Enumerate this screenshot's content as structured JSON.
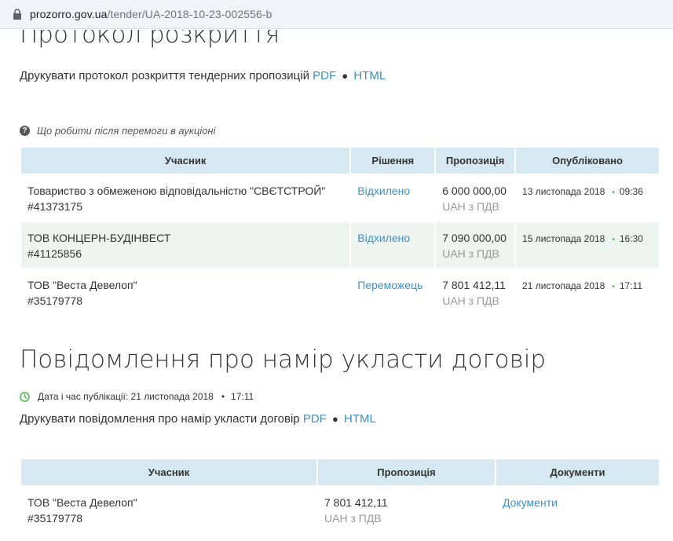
{
  "browser": {
    "url_host": "prozorro.gov.ua",
    "url_path": "/tender/UA-2018-10-23-002556-b"
  },
  "opening": {
    "title": "Протокол розкриття",
    "print_text": "Друкувати протокол розкриття тендерних пропозицій",
    "pdf_label": "PDF",
    "separator": "●",
    "html_label": "HTML",
    "help_text": "Що робити після перемоги в аукціоні",
    "table": {
      "headers": [
        "Учасник",
        "Рішення",
        "Пропозиція",
        "Опубліковано"
      ],
      "rows": [
        {
          "name": "Товариство з обмеженою відповідальністю \"СВЄТСТРОЙ\"",
          "code": "#41373175",
          "decision": "Відхилено",
          "amount": "6 000 000,00",
          "currency": "UAH з ПДВ",
          "date": "13 листопада 2018",
          "time": "09:36"
        },
        {
          "name": "ТОВ КОНЦЕРН-БУДІНВЕСТ",
          "code": "#41125856",
          "decision": "Відхилено",
          "amount": "7 090 000,00",
          "currency": "UAH з ПДВ",
          "date": "15 листопада 2018",
          "time": "16:30"
        },
        {
          "name": "ТОВ \"Веста Девелоп\"",
          "code": "#35179778",
          "decision": "Переможець",
          "amount": "7 801 412,11",
          "currency": "UAH з ПДВ",
          "date": "21 листопада 2018",
          "time": "17:11"
        }
      ]
    }
  },
  "intent": {
    "title": "Повідомлення про намір укласти договір",
    "pub_label": "Дата і час публікації: 21 листопада 2018",
    "pub_time": "17:11",
    "print_text": "Друкувати повідомлення про намір укласти договір",
    "pdf_label": "PDF",
    "separator": "●",
    "html_label": "HTML",
    "table": {
      "headers": [
        "Учасник",
        "Пропозиція",
        "Документи"
      ],
      "rows": [
        {
          "name": "ТОВ \"Веста Девелоп\"",
          "code": "#35179778",
          "amount": "7 801 412,11",
          "currency": "UAH з ПДВ",
          "docs": "Документи"
        }
      ]
    }
  },
  "colors": {
    "link": "#3f8fc6",
    "header_bg": "#d6e8f1",
    "row_shade": "#eef5f0",
    "muted": "#999999",
    "green": "#4bb84b"
  },
  "icons": [
    "lock-icon",
    "question-icon",
    "clock-icon"
  ]
}
